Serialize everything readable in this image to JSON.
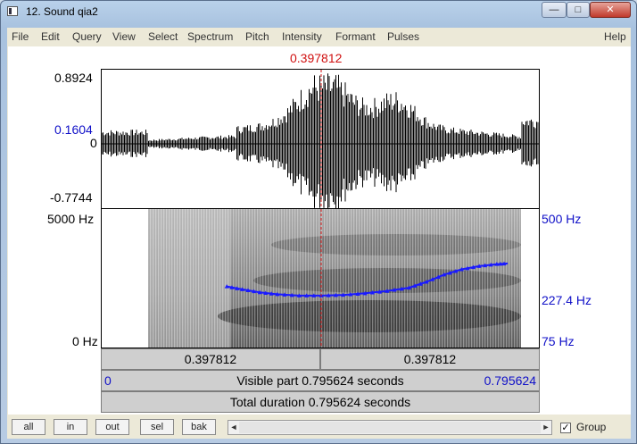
{
  "window": {
    "title": "12. Sound qia2",
    "minimize_label": "—",
    "maximize_label": "□",
    "close_label": "✕"
  },
  "menu": [
    "File",
    "Edit",
    "Query",
    "View",
    "Select",
    "Spectrum",
    "Pitch",
    "Intensity",
    "Formant",
    "Pulses",
    "Help"
  ],
  "cursor": {
    "time_label": "0.397812",
    "fraction": 0.5
  },
  "waveform": {
    "top_label": "0.8924",
    "level_label": "0.1604",
    "zero_label": "0",
    "bottom_label": "-0.7744"
  },
  "spectrogram": {
    "top_label": "5000 Hz",
    "bottom_label": "0 Hz"
  },
  "pitch": {
    "top_label": "500 Hz",
    "mid_label": "227.4 Hz",
    "bottom_label": "75 Hz",
    "color": "#1a1aff",
    "points": [
      [
        0.285,
        264
      ],
      [
        0.32,
        255
      ],
      [
        0.36,
        246
      ],
      [
        0.4,
        240
      ],
      [
        0.45,
        236
      ],
      [
        0.5,
        236
      ],
      [
        0.55,
        238
      ],
      [
        0.6,
        243
      ],
      [
        0.65,
        250
      ],
      [
        0.7,
        260
      ],
      [
        0.74,
        278
      ],
      [
        0.78,
        300
      ],
      [
        0.82,
        316
      ],
      [
        0.86,
        326
      ],
      [
        0.9,
        332
      ],
      [
        0.925,
        334
      ]
    ],
    "f_min": 75,
    "f_max": 500
  },
  "selection_bar": {
    "left": "0.397812",
    "right": "0.397812"
  },
  "visible_bar": {
    "start": "0",
    "text": "Visible part 0.795624 seconds",
    "end": "0.795624"
  },
  "total_bar": {
    "text": "Total duration 0.795624 seconds"
  },
  "buttons": {
    "all": "all",
    "in": "in",
    "out": "out",
    "sel": "sel",
    "bak": "bak"
  },
  "scrollbar": {
    "left_arrow": "◄",
    "right_arrow": "►"
  },
  "group": {
    "label": "Group",
    "checked": true,
    "check_glyph": "✓"
  }
}
